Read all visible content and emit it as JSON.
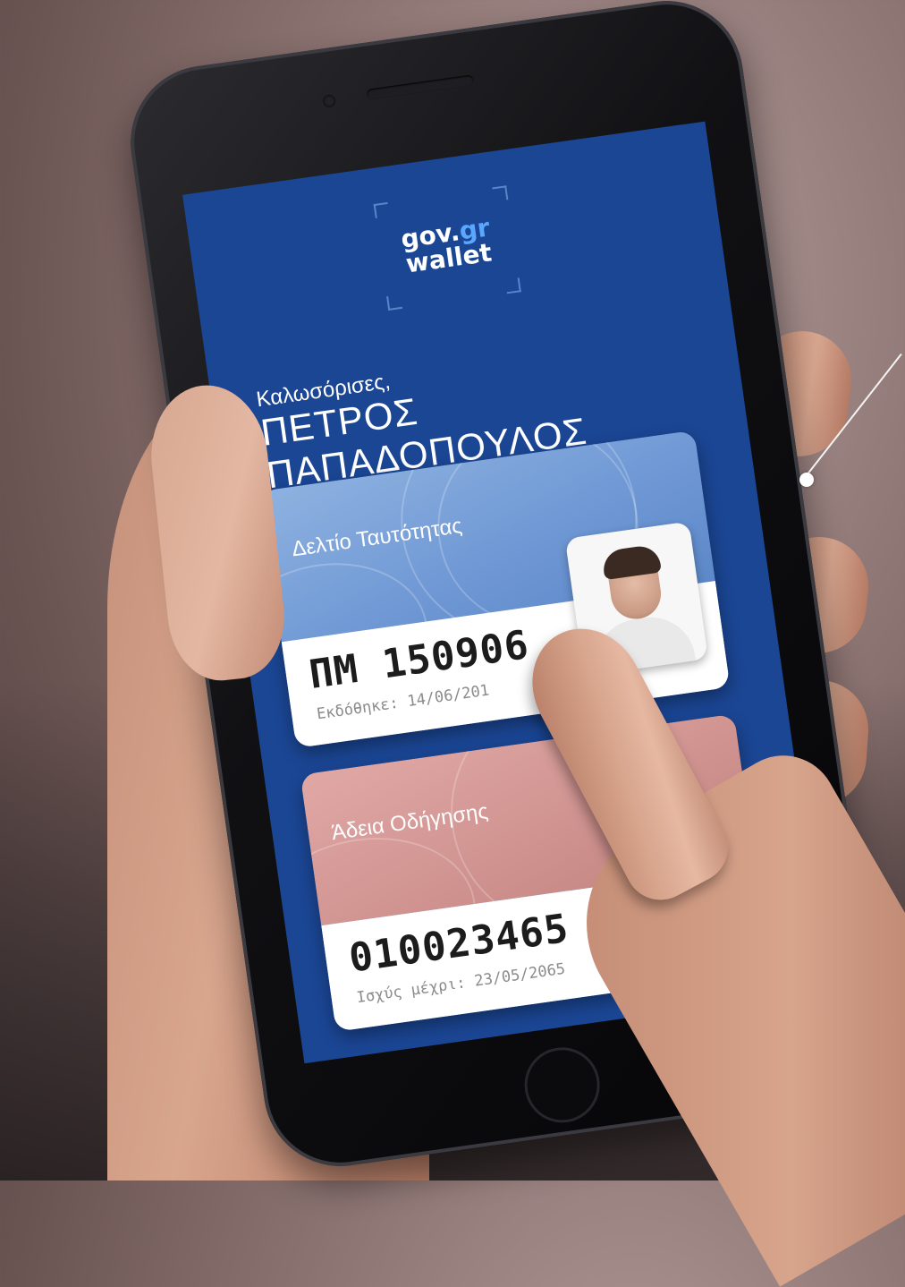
{
  "app": {
    "logo_line1_main": "gov.",
    "logo_line1_accent": "gr",
    "logo_line2": "wallet",
    "accent_color": "#5aa7ff",
    "background_color": "#1b4694"
  },
  "greeting": {
    "welcome": "Καλωσόρισες,",
    "name": "ΠΕΤΡΟΣ ΠΑΠΑΔΟΠΟΥΛΟΣ"
  },
  "cards": [
    {
      "title": "Δελτίο Ταυτότητας",
      "number": "ΠΜ 150906",
      "meta": "Εκδόθηκε: 14/06/201",
      "color": "#7aa0d8"
    },
    {
      "title": "Άδεια Οδήγησης",
      "number": "010023465",
      "meta": "Ισχύς μέχρι: 23/05/2065",
      "color": "#d49a97"
    }
  ]
}
